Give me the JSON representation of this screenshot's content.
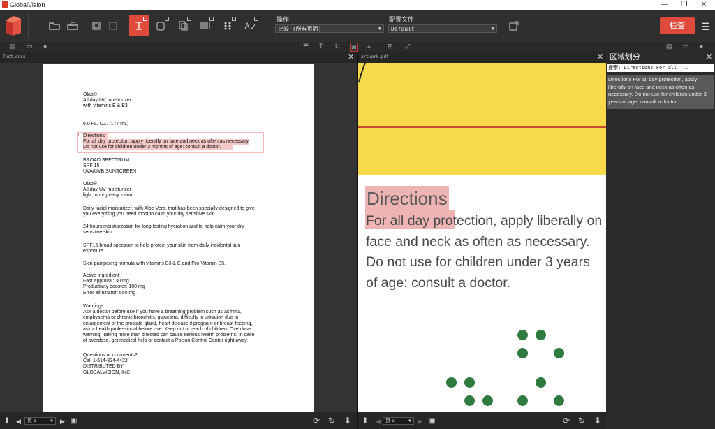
{
  "window": {
    "title": "GlobalVision",
    "minimize": "—",
    "restore": "❐",
    "close": "✕"
  },
  "toolbar": {
    "operation_label": "操作",
    "operation_value": "比较 (所有页面)",
    "profile_label": "配置文件",
    "profile_value": "Default",
    "check_button": "检查",
    "menu_icon": "☰",
    "icons": [
      "folder-icon",
      "scanner-icon",
      "frame-icon",
      "frame-alt-icon",
      "text-icon",
      "copy-icon",
      "layers-icon",
      "barcode-icon",
      "braille-icon",
      "spellcheck-icon",
      "export-icon"
    ]
  },
  "left_panel": {
    "tab_name": "Test.docx",
    "close": "✕",
    "paragraphs": [
      "Olab®\nAll day UV moisturizer\nwith vitamins E & B3",
      "6.0 FL. OZ. (177 mL)",
      "Directions\nFor all day protection, apply liberally on face and neck as often as necessary.\nDo not use for children under 3 months of age: consult a doctor.",
      "BROAD SPECTRUM\nSPF 15\nUVA/UVB SUNSCREEN",
      "Olab®\nAll day UV moisturizer\nlight, non-greasy lotion",
      "Daily facial moisturizer, with Aloe Vera, that has been specially designed to give\nyou everything you need most to calm your dry sensitive skin.",
      "24 hours moisturization for long lasting hycration and to help calm your dry\nsensitive skin.",
      "SPF15 broad spectrum to help protect your skin from daily incidental sun\nexposure.",
      "Skin pampering formula with vitamins B3 & E and Pro-Vitamin B5.",
      "Active ingredient\nFast approval: 30 mg\nProductivity booster: 100 mg\nError eliminator: 550 mg",
      "Warnings\nAsk a doctor before use if you have a breathing problem such as asthma,\nemphysema or chronic bronchitis, glaucorra, difficulty in urination due to\nenlargement of the prostate gland, heart disease if pregnant or breast-feeding,\nask a health professional before use. Keep out of reach of children. Overdose\nwarning: Taking more than directed can cause serious health problems. In case\nof overdose, get medical help or contact a Poison Control Center right away.",
      "Questions or comments?\nCall 1-514-824-4422\nDISTRIBUTED BY\nGLOBALVISION, INC."
    ],
    "highlight_number": "1",
    "page_select": "页 1"
  },
  "right_panel": {
    "tab_name": "Artwork.pdf",
    "close": "✕",
    "heading": "Directions",
    "body": "For all day protection, apply liberally on\nface and neck as often as necessary.\nDo not use for children under 3 years\nof age: consult a doctor.",
    "page_select": "页 1"
  },
  "sidebar": {
    "title": "区域划分",
    "close": "✕",
    "search": "搜索:  Directions For all ...",
    "item_text": "Directions For all day protection, apply liberally on face and neck as often as necessary. Do not use for children under 3 years of age: consult a doctor."
  },
  "colors": {
    "accent": "#e04a3a",
    "highlight": "#f6c9c9",
    "artwork_yellow": "#f8d94a",
    "artwork_green": "#2f7a3e"
  }
}
